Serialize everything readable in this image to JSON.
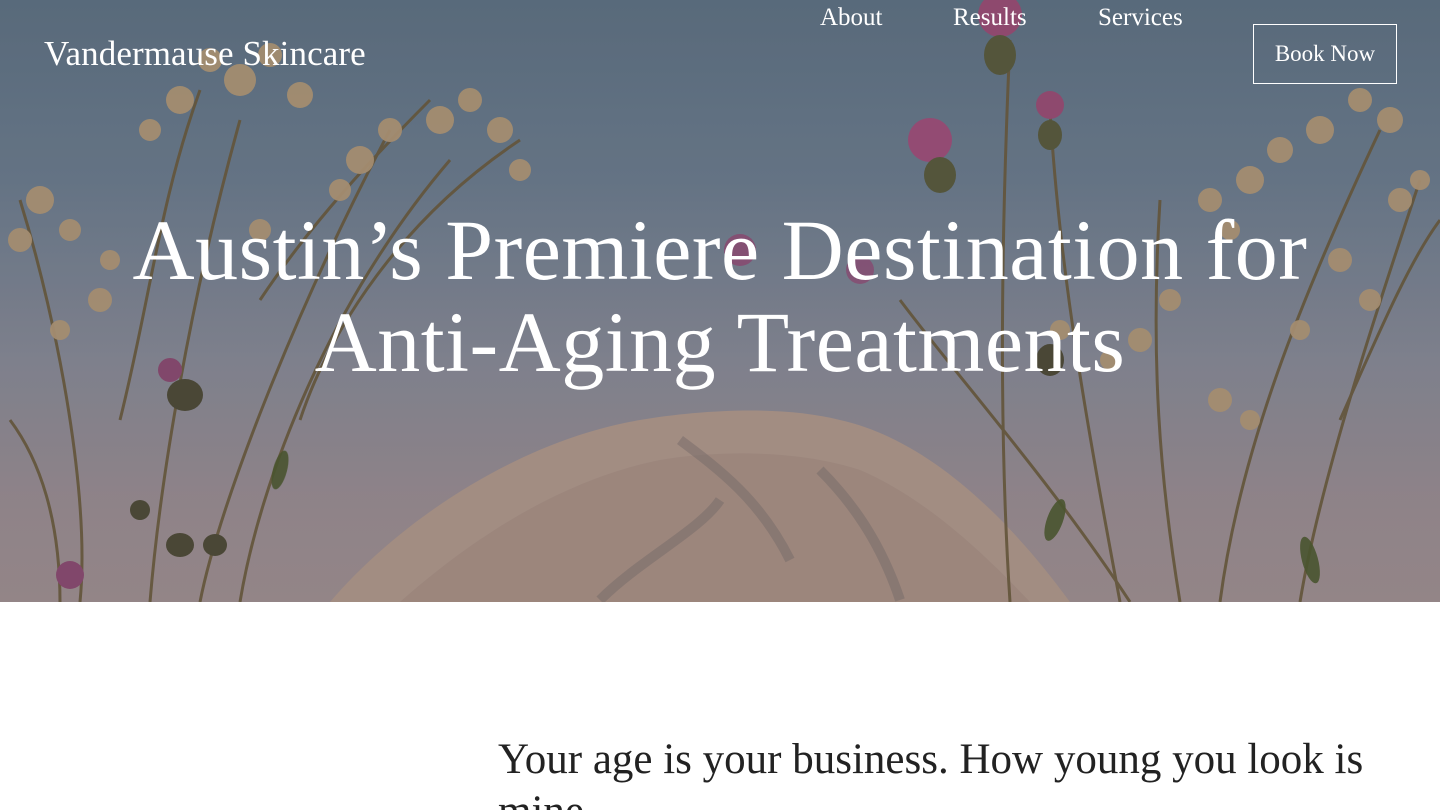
{
  "brand": {
    "name": "Vandermause Skincare"
  },
  "nav": {
    "items": [
      {
        "label": "About"
      },
      {
        "label": "Results"
      },
      {
        "label": "Services"
      }
    ],
    "cta_label": "Book Now"
  },
  "hero": {
    "headline": "Austin’s Premiere Destination for Anti-Aging Treatments",
    "background": "dried wildflowers and thistles in front of a large rock against a dusk sky"
  },
  "intro": {
    "tagline": "Your age is your business. How young you look is mine."
  },
  "colors": {
    "sky_top": "#5f7284",
    "sky_bottom": "#a29192",
    "rock": "#b49c8f",
    "text_dark": "#222222",
    "text_light": "#ffffff"
  }
}
